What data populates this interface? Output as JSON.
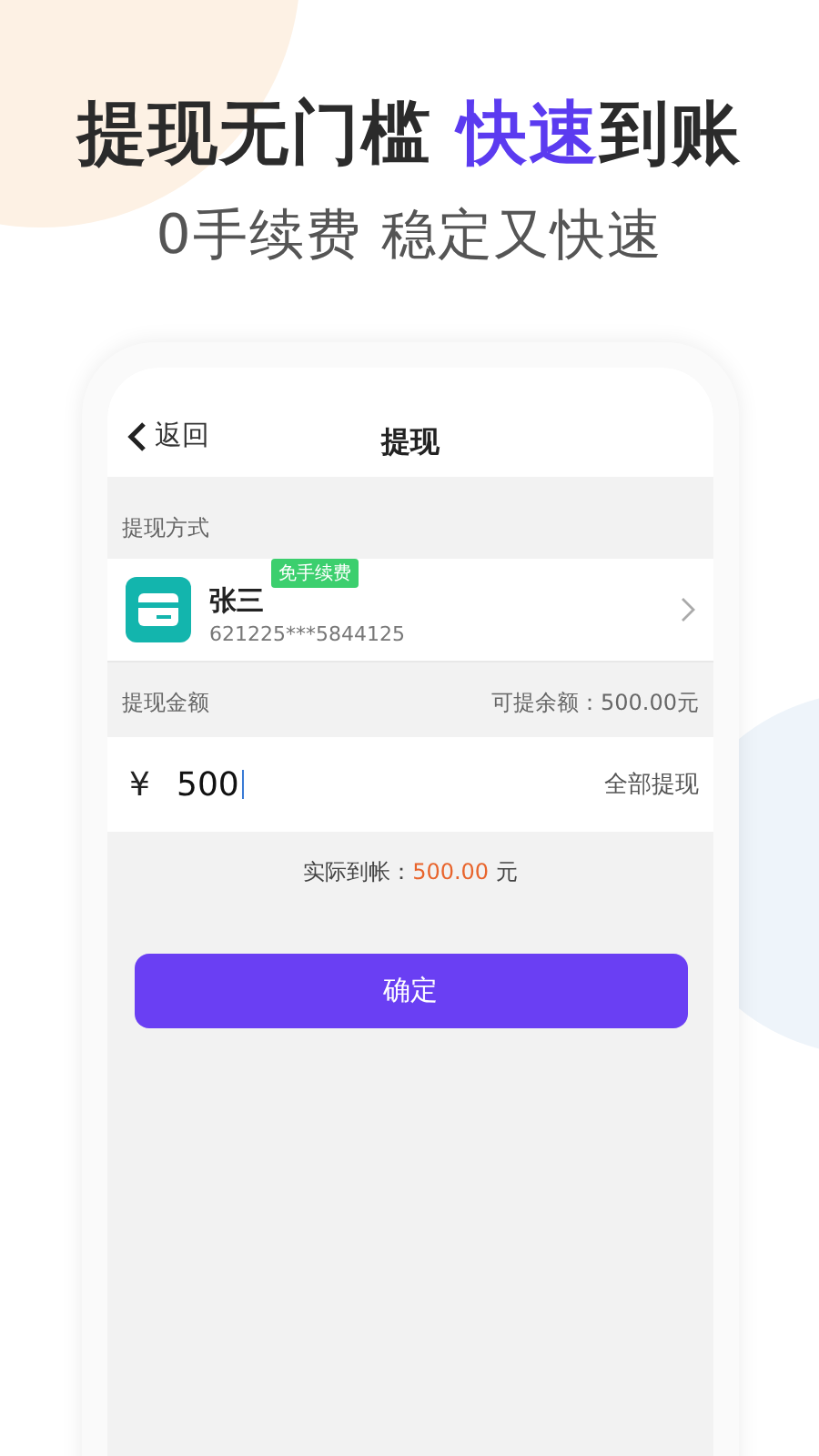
{
  "headline": {
    "parts": [
      {
        "text": "提现无门槛 ",
        "highlight": false
      },
      {
        "text": "快速",
        "highlight": true
      },
      {
        "text": "到账",
        "highlight": false
      }
    ],
    "subtitle": "0手续费 稳定又快速"
  },
  "nav": {
    "back": "返回",
    "title": "提现"
  },
  "method": {
    "label": "提现方式",
    "name": "张三",
    "badge": "免手续费",
    "card_number": "621225***5844125"
  },
  "amount": {
    "label": "提现金额",
    "available": "可提余额：500.00元",
    "currency": "¥",
    "value": "500",
    "all_button": "全部提现"
  },
  "actual": {
    "label": "实际到帐：",
    "amount": "500.00",
    "unit": "元"
  },
  "confirm_button": "确定"
}
